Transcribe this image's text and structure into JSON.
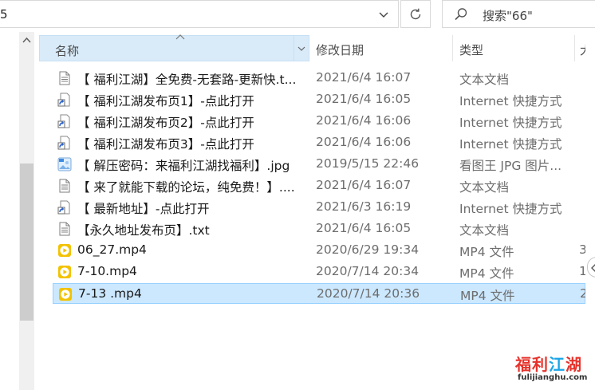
{
  "address_bar": {
    "path_fragment": "5"
  },
  "search": {
    "text": "搜索\"66\""
  },
  "columns": {
    "name": "名称",
    "date": "修改日期",
    "type": "类型",
    "size": "大"
  },
  "files": [
    {
      "name": "【 福利江湖】全免费-无套路-更新快.t...",
      "date": "2021/6/4 16:07",
      "type": "文本文档",
      "size": "",
      "icon": "text-file-icon"
    },
    {
      "name": "【 福利江湖发布页1】-点此打开",
      "date": "2021/6/4 16:05",
      "type": "Internet 快捷方式",
      "size": "",
      "icon": "shortcut-icon"
    },
    {
      "name": "【 福利江湖发布页2】-点此打开",
      "date": "2021/6/4 16:06",
      "type": "Internet 快捷方式",
      "size": "",
      "icon": "shortcut-icon"
    },
    {
      "name": "【 福利江湖发布页3】-点此打开",
      "date": "2021/6/4 16:06",
      "type": "Internet 快捷方式",
      "size": "",
      "icon": "shortcut-icon"
    },
    {
      "name": "【 解压密码：来福利江湖找福利】.jpg",
      "date": "2019/5/15 22:46",
      "type": "看图王 JPG 图片...",
      "size": "",
      "icon": "image-file-icon"
    },
    {
      "name": "【 来了就能下载的论坛，纯免费！】....",
      "date": "2021/6/4 16:07",
      "type": "文本文档",
      "size": "",
      "icon": "text-file-icon"
    },
    {
      "name": "【 最新地址】-点此打开",
      "date": "2021/6/3 16:19",
      "type": "Internet 快捷方式",
      "size": "",
      "icon": "shortcut-icon"
    },
    {
      "name": "【永久地址发布页】.txt",
      "date": "2021/6/4 16:05",
      "type": "文本文档",
      "size": "",
      "icon": "text-file-icon"
    },
    {
      "name": "06_27.mp4",
      "date": "2020/6/29 19:34",
      "type": "MP4 文件",
      "size": "3",
      "icon": "video-file-icon"
    },
    {
      "name": "7-10.mp4",
      "date": "2020/7/14 20:34",
      "type": "MP4 文件",
      "size": "1",
      "icon": "video-file-icon"
    },
    {
      "name": "7-13 .mp4",
      "date": "2020/7/14 20:36",
      "type": "MP4 文件",
      "size": "2",
      "icon": "video-file-icon",
      "selected": true
    }
  ],
  "watermark": {
    "title_red_1": "福利",
    "title_blue": "江",
    "title_red_2": "湖",
    "url": "fulijianghu.com"
  },
  "colors": {
    "selection_bg": "#cce8ff",
    "selection_border": "#99d1ff",
    "header_active": "#d9ebf9",
    "video_icon": "#f2c200",
    "watermark_red": "#e6322b",
    "watermark_blue": "#1aa5e8"
  }
}
